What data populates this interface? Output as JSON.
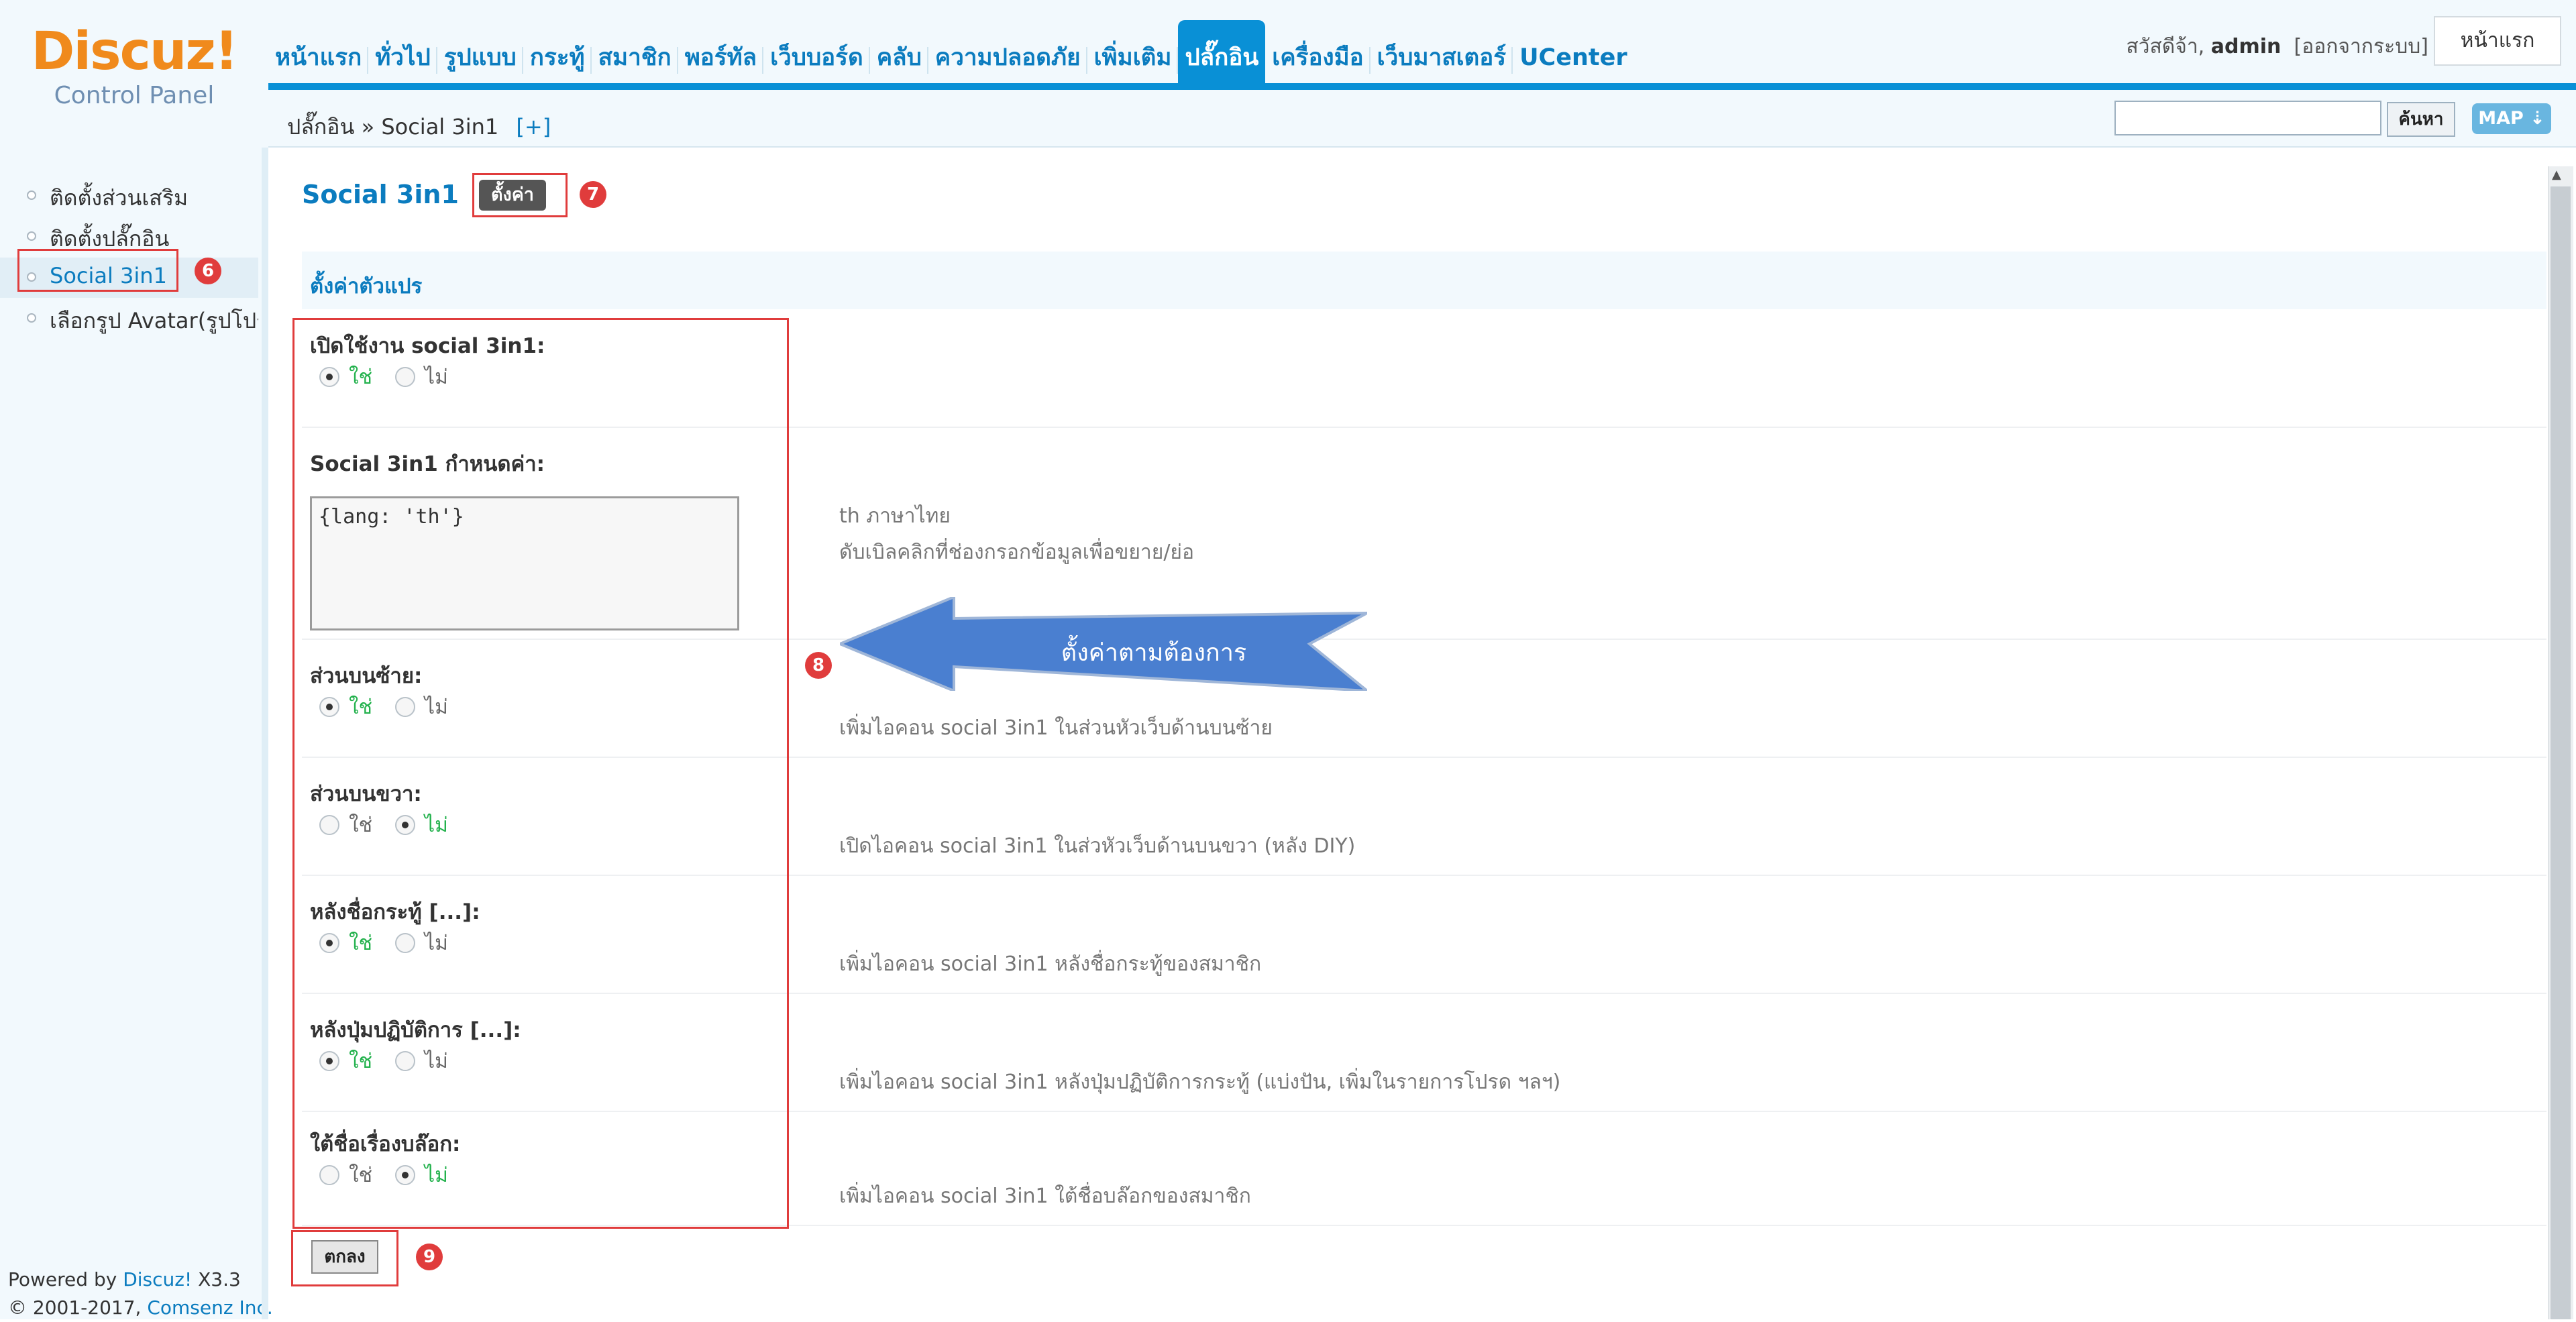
{
  "logo": {
    "brand": "Discuz!",
    "subtitle": "Control Panel"
  },
  "nav": {
    "items": [
      "หน้าแรก",
      "ทั่วไป",
      "รูปแบบ",
      "กระทู้",
      "สมาชิก",
      "พอร์ทัล",
      "เว็บบอร์ด",
      "คลับ",
      "ความปลอดภัย",
      "เพิ่มเติม",
      "ปลั๊กอิน",
      "เครื่องมือ",
      "เว็บมาสเตอร์",
      "UCenter"
    ],
    "active": "ปลั๊กอิน"
  },
  "user": {
    "greeting": "สวัสดีจ้า,",
    "name": "admin",
    "logout": "[ออกจากระบบ]",
    "home": "หน้าแรก"
  },
  "breadcrumb": {
    "path": "ปลั๊กอิน » Social 3in1",
    "plus": "[+]"
  },
  "search": {
    "button": "ค้นหา",
    "map": "MAP ⇣"
  },
  "sidebar": {
    "items": [
      {
        "label": "ติดตั้งส่วนเสริม"
      },
      {
        "label": "ติดตั้งปลั๊กอิน"
      },
      {
        "label": "Social 3in1"
      },
      {
        "label": "เลือกรูป Avatar(รูปโปรไฟล์)"
      }
    ]
  },
  "footer": {
    "powered": "Powered by",
    "brand": "Discuz!",
    "version": "X3.3",
    "copyright": "© 2001-2017,",
    "company": "Comsenz Inc."
  },
  "main": {
    "title": "Social 3in1",
    "settings_tab": "ตั้งค่า",
    "section": "ตั้งค่าตัวแปร",
    "options": {
      "yes": "ใช่",
      "no": "ไม่"
    },
    "settings": [
      {
        "label": "เปิดใช้งาน social 3in1:",
        "value": "yes",
        "hint": ""
      },
      {
        "label": "Social 3in1 กำหนดค่า:",
        "value": "{lang: 'th'}",
        "hint": "th ภาษาไทย",
        "hint2": "ดับเบิลคลิกที่ช่องกรอกข้อมูลเพื่อขยาย/ย่อ"
      },
      {
        "label": "ส่วนบนซ้าย:",
        "value": "yes",
        "hint": "เพิ่มไอคอน social 3in1 ในส่วนหัวเว็บด้านบนซ้าย"
      },
      {
        "label": "ส่วนบนขวา:",
        "value": "no",
        "hint": "เปิดไอคอน social 3in1 ในส่วหัวเว็บด้านบนขวา (หลัง DIY)"
      },
      {
        "label": "หลังชื่อกระทู้ [...]:",
        "value": "yes",
        "hint": "เพิ่มไอคอน social 3in1 หลังชื่อกระทู้ของสมาชิก"
      },
      {
        "label": "หลังปุ่มปฏิบัติการ [...]:",
        "value": "yes",
        "hint": "เพิ่มไอคอน social 3in1 หลังปุ่มปฏิบัติการกระทู้ (แบ่งปัน, เพิ่มในรายการโปรด ฯลฯ)"
      },
      {
        "label": "ใต้ชื่อเรื่องบล๊อก:",
        "value": "no",
        "hint": "เพิ่มไอคอน social 3in1 ใต้ชื่อบล๊อกของสมาชิก"
      }
    ],
    "submit": "ตกลง"
  },
  "annotations": {
    "markers": [
      "6",
      "7",
      "8",
      "9"
    ],
    "arrow_text": "ตั้งค่าตามต้องการ",
    "color": "#e03c3c",
    "arrow_color": "#4a7fd0"
  }
}
